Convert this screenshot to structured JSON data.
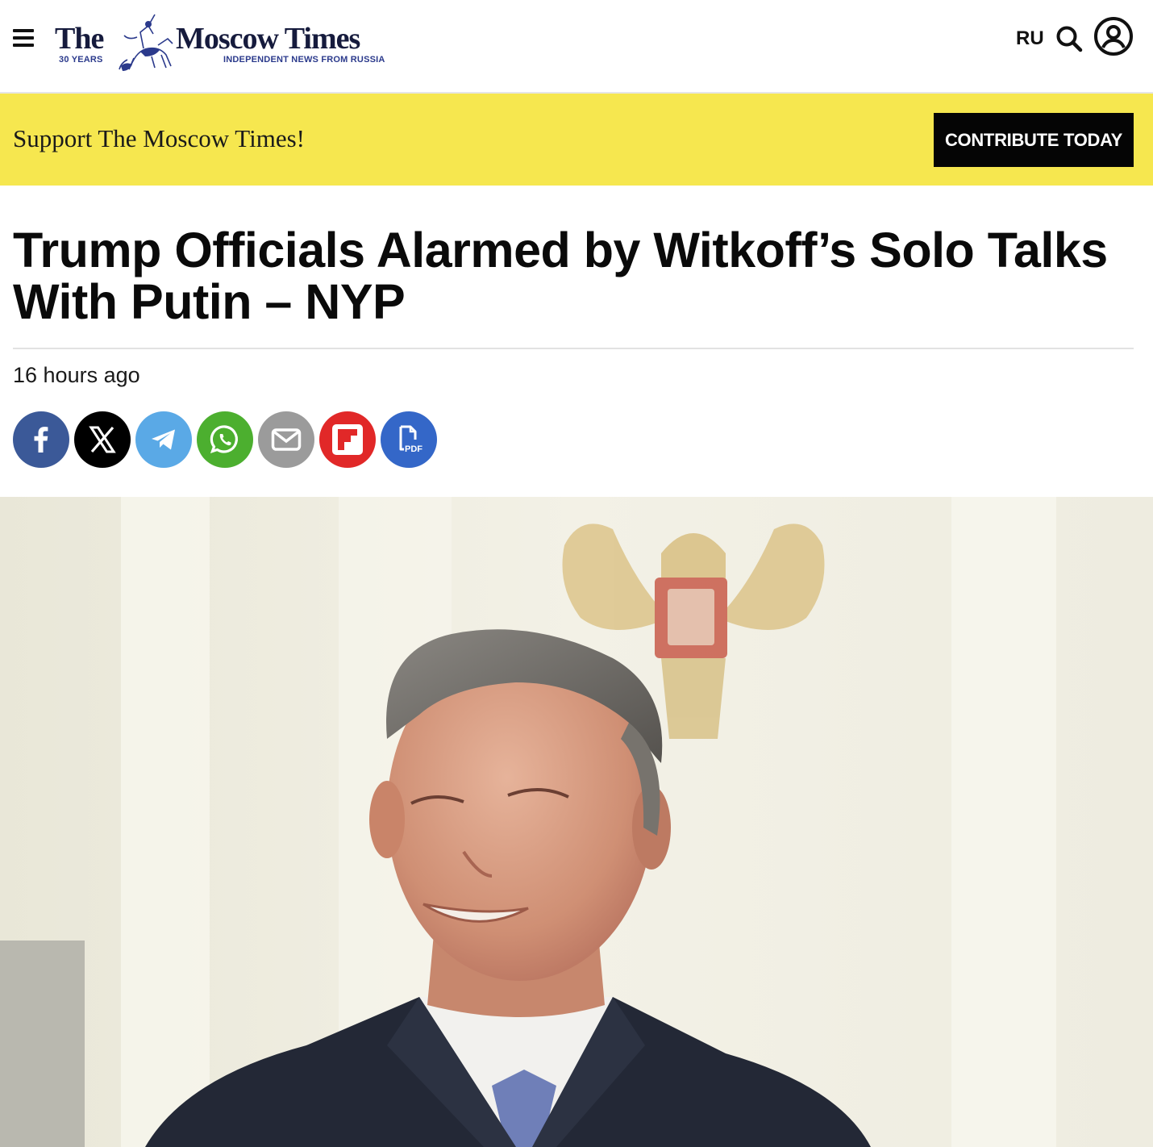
{
  "header": {
    "menu_icon": "hamburger-menu-icon",
    "logo": {
      "the": "The",
      "name": "Moscow Times",
      "years": "30 YEARS",
      "tagline": "INDEPENDENT NEWS FROM RUSSIA",
      "emblem_icon": "st-george-emblem-icon"
    },
    "language": "RU",
    "search_icon": "search-icon",
    "account_icon": "user-circle-icon"
  },
  "support_banner": {
    "text": "Support The Moscow Times!",
    "button_label": "CONTRIBUTE TODAY",
    "background": "#f6e74f"
  },
  "article": {
    "headline": "Trump Officials Alarmed by Witkoff’s Solo Talks With Putin – NYP",
    "published": "16 hours ago",
    "share_buttons": [
      {
        "name": "facebook",
        "icon": "facebook-icon",
        "color": "#3b5998"
      },
      {
        "name": "x",
        "icon": "x-icon",
        "color": "#000000"
      },
      {
        "name": "telegram",
        "icon": "telegram-icon",
        "color": "#5aa9e6"
      },
      {
        "name": "whatsapp",
        "icon": "whatsapp-icon",
        "color": "#4caf2f"
      },
      {
        "name": "email",
        "icon": "email-icon",
        "color": "#9b9b9b"
      },
      {
        "name": "flipboard",
        "icon": "flipboard-icon",
        "color": "#e12828"
      },
      {
        "name": "pdf",
        "icon": "pdf-icon",
        "color": "#3467c8",
        "label": "PDF"
      }
    ],
    "hero_image": {
      "subject": "man-in-suit-photo"
    }
  }
}
